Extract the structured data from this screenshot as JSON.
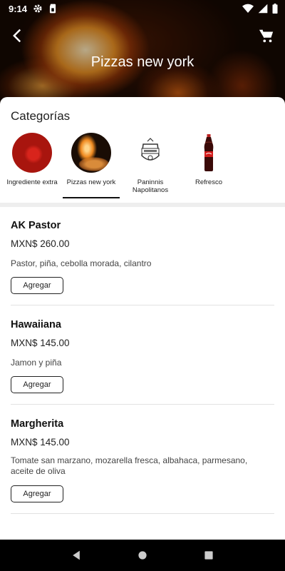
{
  "status_bar": {
    "time": "9:14",
    "icons": [
      "gear-icon",
      "sim-card-icon",
      "wifi-icon",
      "signal-icon",
      "battery-icon"
    ]
  },
  "header": {
    "title": "Pizzas new york",
    "back_icon": "arrow-back-icon",
    "cart_icon": "shopping-cart-icon"
  },
  "categories": {
    "title": "Categorías",
    "selected": "Pizzas new york",
    "items": [
      {
        "label": "Ingrediente extra"
      },
      {
        "label": "Pizzas new york"
      },
      {
        "label": "Paninnis Napolitanos"
      },
      {
        "label": "Refresco"
      }
    ]
  },
  "products": [
    {
      "name": "AK Pastor",
      "price": "MXN$ 260.00",
      "description": "Pastor, piña, cebolla morada, cilantro",
      "button": "Agregar"
    },
    {
      "name": "Hawaiiana",
      "price": "MXN$ 145.00",
      "description": "Jamon y piña",
      "button": "Agregar"
    },
    {
      "name": "Margherita",
      "price": "MXN$ 145.00",
      "description": "Tomate san marzano, mozarella fresca, albahaca, parmesano, aceite de oliva",
      "button": "Agregar"
    }
  ],
  "navigation": {
    "icons": [
      "nav-back-icon",
      "nav-home-icon",
      "nav-recents-icon"
    ]
  }
}
